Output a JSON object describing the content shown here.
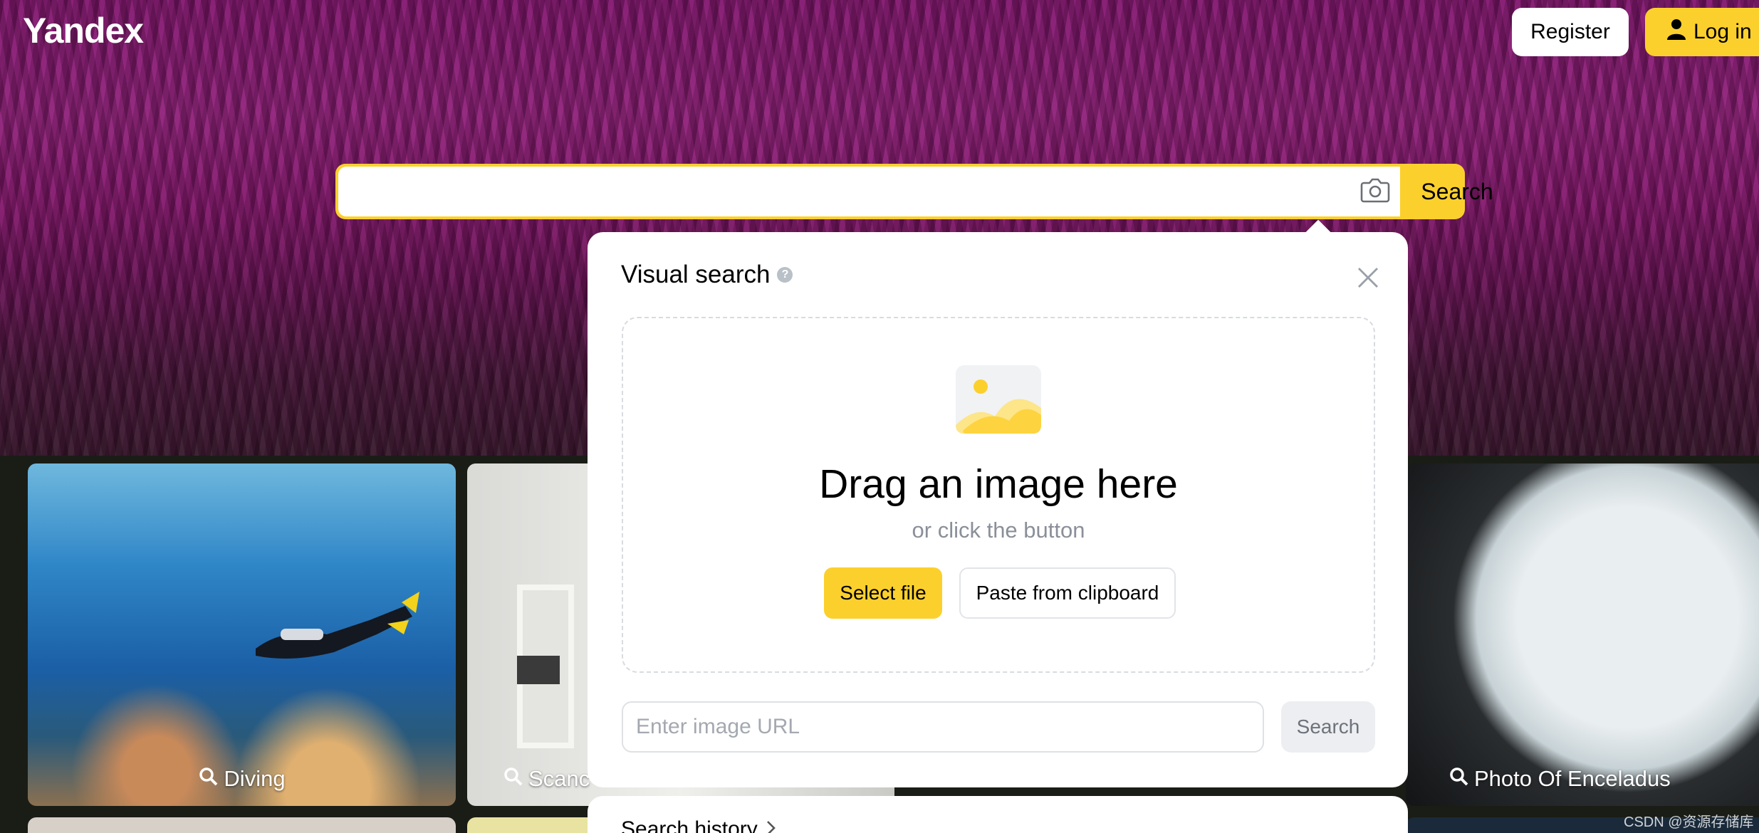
{
  "header": {
    "logo": "Yandex",
    "register_label": "Register",
    "login_label": "Log in"
  },
  "search": {
    "value": "",
    "button_label": "Search"
  },
  "tiles": [
    {
      "caption": "Diving"
    },
    {
      "caption": "Scanc"
    },
    {
      "caption": "Photo Of Enceladus"
    }
  ],
  "visual_search": {
    "title": "Visual search",
    "help": "?",
    "drop_title": "Drag an image here",
    "drop_subtitle": "or click the button",
    "select_file_label": "Select file",
    "paste_label": "Paste from clipboard",
    "url_placeholder": "Enter image URL",
    "url_search_label": "Search"
  },
  "history": {
    "label": "Search history"
  },
  "watermark": "CSDN @资源存储库",
  "colors": {
    "accent": "#fcd02c"
  }
}
